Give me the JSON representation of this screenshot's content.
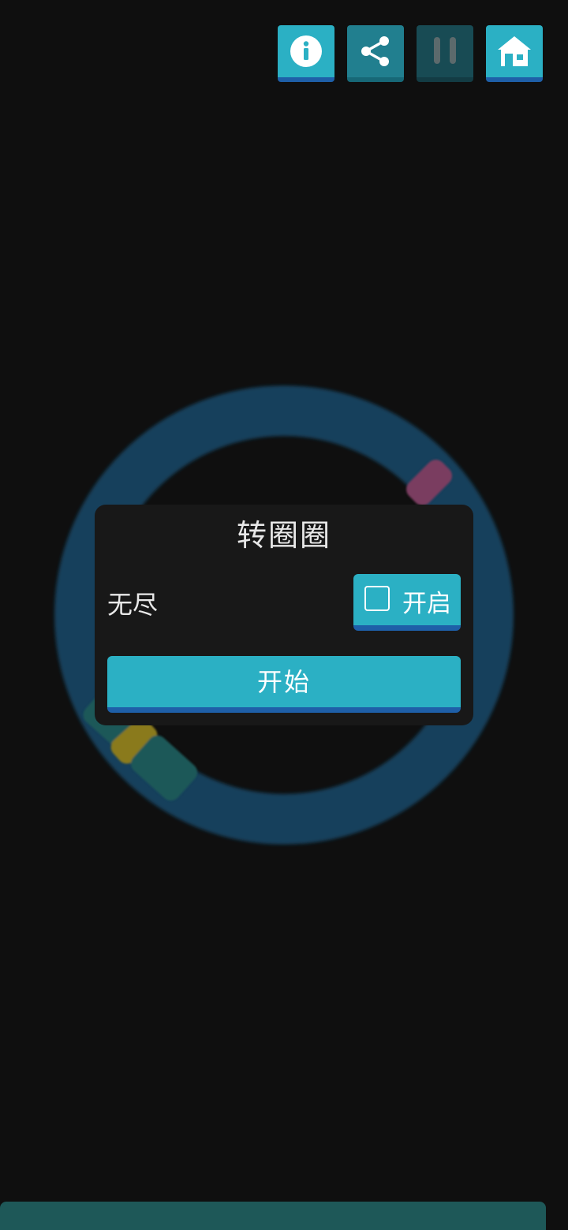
{
  "toolbar": {
    "info_icon": "info-icon",
    "share_icon": "share-icon",
    "pause_icon": "pause-icon",
    "home_icon": "home-icon"
  },
  "dialog": {
    "title": "转圈圈",
    "endless_label": "无尽",
    "toggle_label": "开启",
    "toggle_checked": false,
    "start_label": "开始"
  },
  "colors": {
    "background": "#0f0f0f",
    "accent": "#2bb0c4",
    "accent_shadow": "#1e5fa8",
    "ring": "#133f5c",
    "dialog": "#181818",
    "segment_pink": "#7a3d60",
    "segment_yellow": "#8a7a1e",
    "segment_teal": "#1e5858"
  }
}
